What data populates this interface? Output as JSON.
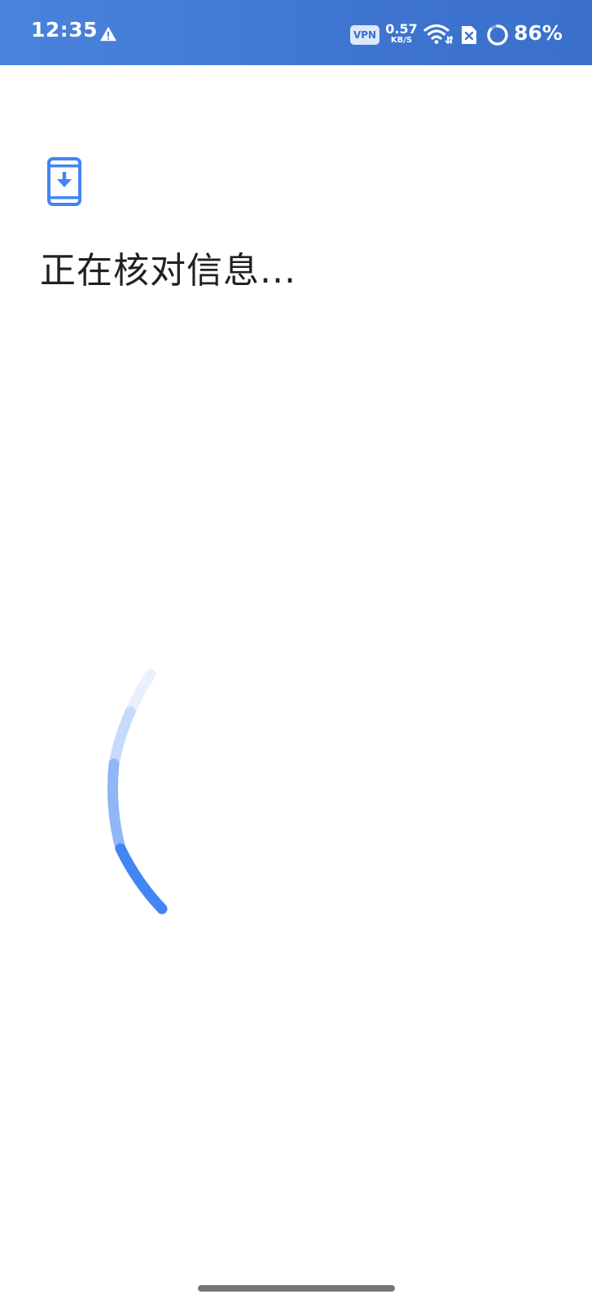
{
  "status_bar": {
    "time": "12:35",
    "alert_icon": "warning-triangle-icon",
    "vpn_label": "VPN",
    "net_speed_value": "0.57",
    "net_speed_unit": "KB/S",
    "wifi_icon": "wifi-icon",
    "sim_icon": "no-sim-icon",
    "battery_percent": 86,
    "battery_text": "86%"
  },
  "main": {
    "app_icon": "phone-download-icon",
    "title": "正在核对信息..."
  },
  "loading": {
    "icon": "loading-spinner-icon"
  },
  "colors": {
    "status_bar": "#3f76d2",
    "accent": "#4285f4",
    "text": "#202124"
  }
}
